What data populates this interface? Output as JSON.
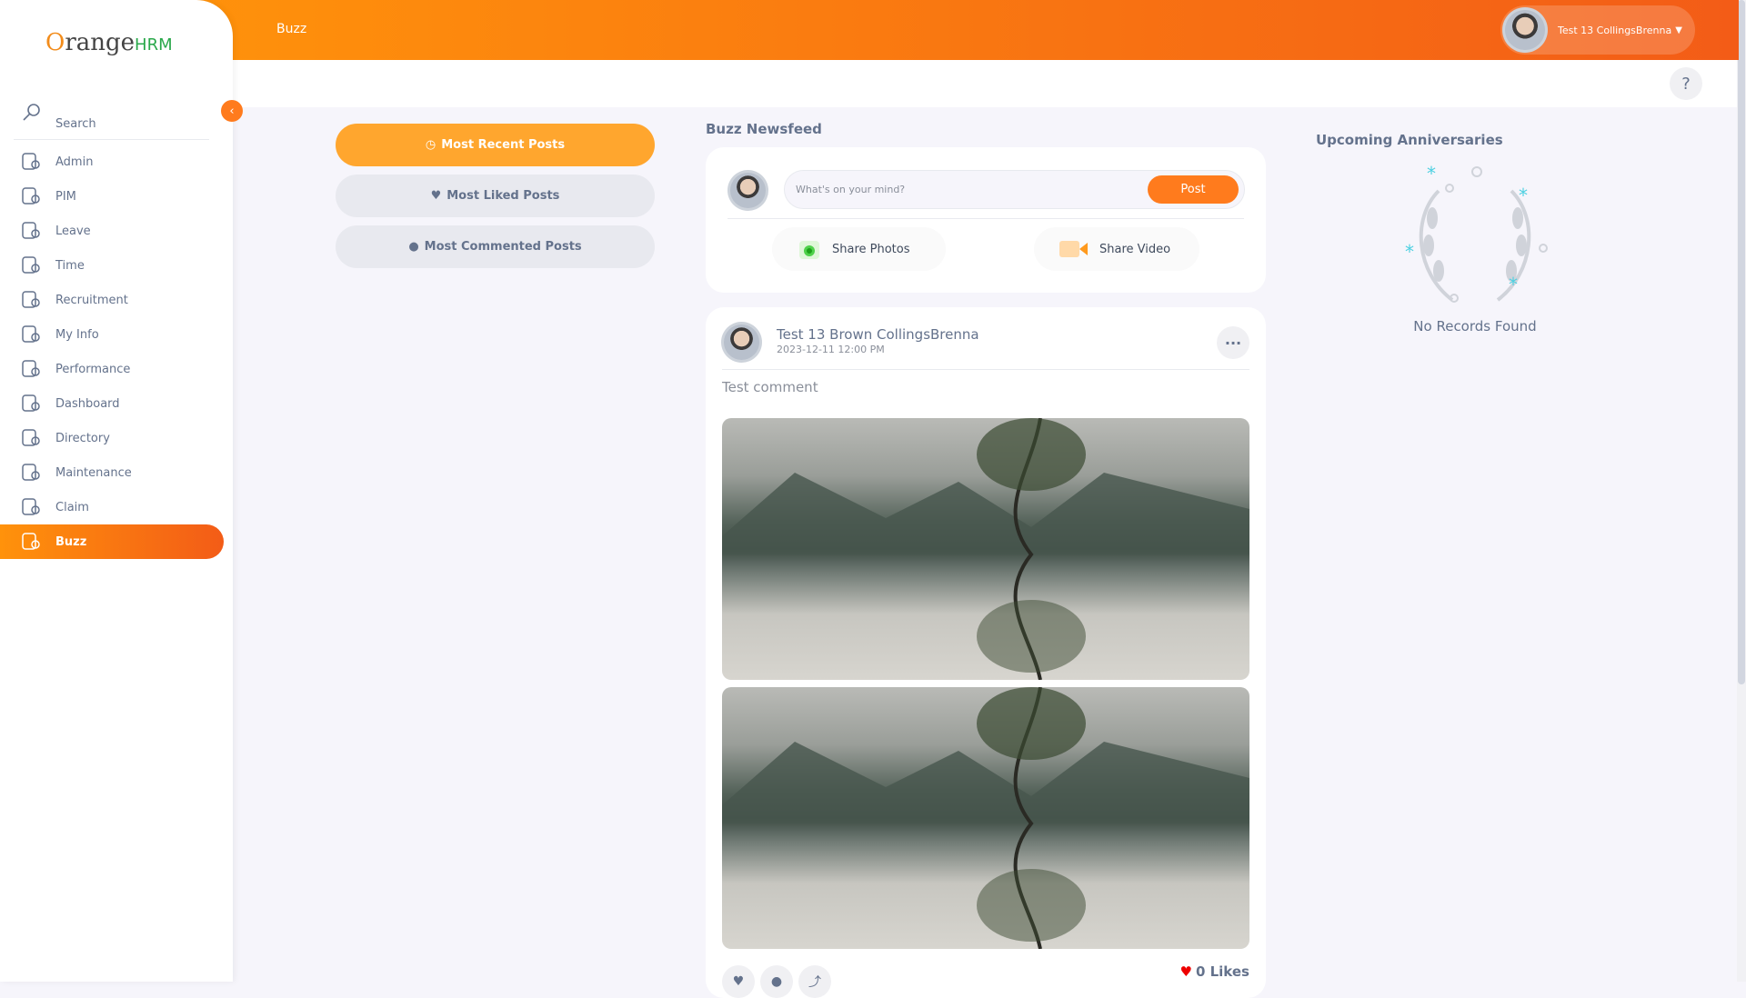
{
  "app": {
    "logo_text": "OrangeHRM",
    "page_title": "Buzz",
    "user_name": "Test 13 CollingsBrenna",
    "help_label": "?"
  },
  "sidebar": {
    "search_placeholder": "Search",
    "items": [
      {
        "label": "Admin",
        "icon": "admin-icon"
      },
      {
        "label": "PIM",
        "icon": "pim-icon"
      },
      {
        "label": "Leave",
        "icon": "leave-icon"
      },
      {
        "label": "Time",
        "icon": "time-icon"
      },
      {
        "label": "Recruitment",
        "icon": "recruitment-icon"
      },
      {
        "label": "My Info",
        "icon": "my-info-icon"
      },
      {
        "label": "Performance",
        "icon": "performance-icon"
      },
      {
        "label": "Dashboard",
        "icon": "dashboard-icon"
      },
      {
        "label": "Directory",
        "icon": "directory-icon"
      },
      {
        "label": "Maintenance",
        "icon": "maintenance-icon"
      },
      {
        "label": "Claim",
        "icon": "claim-icon"
      },
      {
        "label": "Buzz",
        "icon": "buzz-icon",
        "active": true
      }
    ]
  },
  "filters": [
    {
      "label": "Most Recent Posts",
      "icon": "clock-icon",
      "active": true
    },
    {
      "label": "Most Liked Posts",
      "icon": "heart-icon"
    },
    {
      "label": "Most Commented Posts",
      "icon": "comment-icon"
    }
  ],
  "newsfeed": {
    "title": "Buzz Newsfeed",
    "composer_placeholder": "What's on your mind?",
    "post_label": "Post",
    "share_photos": "Share Photos",
    "share_video": "Share Video"
  },
  "post": {
    "author": "Test 13 Brown CollingsBrenna",
    "date": "2023-12-11 12:00 PM",
    "text": "Test comment",
    "likes": "0 Likes"
  },
  "anniversaries": {
    "title": "Upcoming Anniversaries",
    "empty": "No Records Found"
  },
  "colors": {
    "accent": "#ff7b1d",
    "active_filter": "#ffa62e"
  }
}
